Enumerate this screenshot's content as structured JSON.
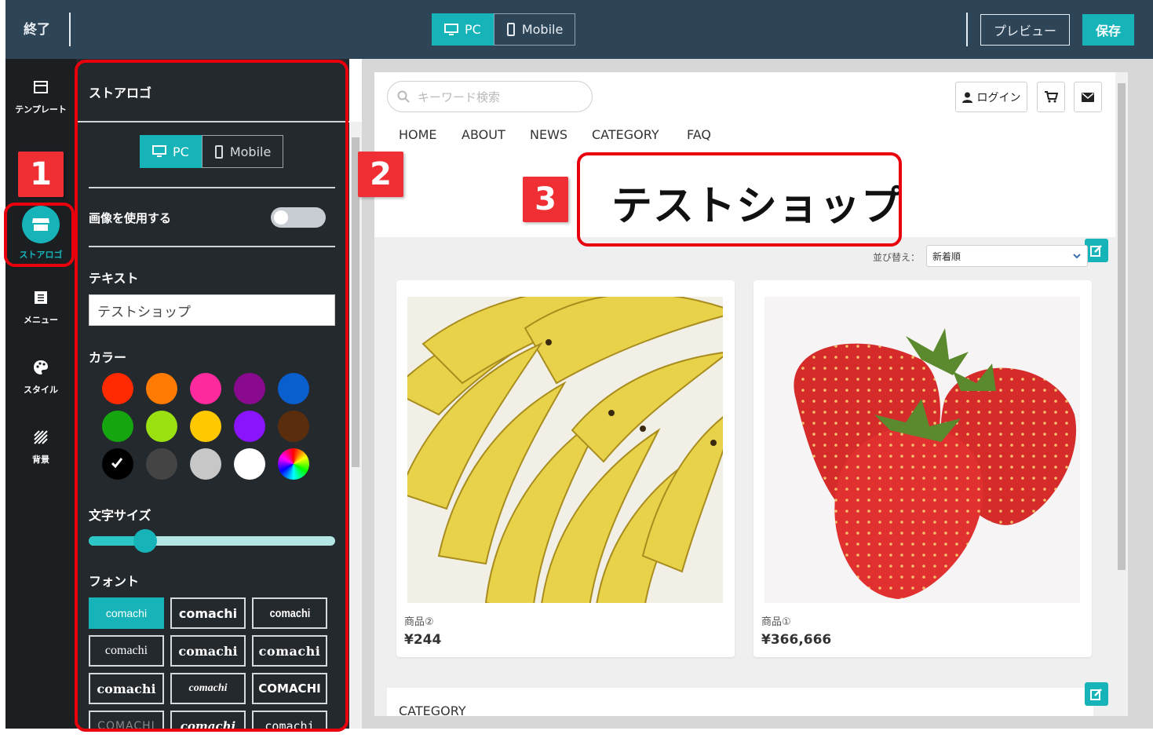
{
  "topbar": {
    "exit_label": "終了",
    "pc_label": "PC",
    "mobile_label": "Mobile",
    "preview_label": "プレビュー",
    "save_label": "保存"
  },
  "rail": {
    "items": [
      {
        "label": "テンプレート",
        "icon": "template-icon"
      },
      {
        "label": "ストアロゴ",
        "icon": "store-icon",
        "active": true
      },
      {
        "label": "メニュー",
        "icon": "menu-icon"
      },
      {
        "label": "スタイル",
        "icon": "palette-icon"
      },
      {
        "label": "背景",
        "icon": "background-icon"
      }
    ]
  },
  "panel": {
    "title": "ストアロゴ",
    "pc_label": "PC",
    "mobile_label": "Mobile",
    "use_image_label": "画像を使用する",
    "use_image_on": false,
    "text_label": "テキスト",
    "text_value": "テストショップ",
    "color_label": "カラー",
    "colors": [
      "#ff2a00",
      "#ff7a00",
      "#ff2a9e",
      "#8a0a8f",
      "#0a5fcf",
      "#15a60f",
      "#9be010",
      "#ffc800",
      "#8b14ff",
      "#5a2e0c",
      "#000000",
      "#444444",
      "#c7c7c7",
      "#ffffff",
      "rainbow"
    ],
    "selected_color": "#000000",
    "size_label": "文字サイズ",
    "size_value": 0.23,
    "font_label": "フォント",
    "fonts": [
      "comachi",
      "comachi",
      "comachi",
      "comachi",
      "comachi",
      "comachi",
      "comachi",
      "comachi",
      "COMACHI",
      "COMACHI",
      "comachi",
      "comachi"
    ]
  },
  "store": {
    "search_placeholder": "キーワード検索",
    "login_label": "ログイン",
    "nav": [
      "HOME",
      "ABOUT",
      "NEWS",
      "CATEGORY",
      "FAQ"
    ],
    "logo_text": "テストショップ",
    "sort_label": "並び替え：",
    "sort_value": "新着順",
    "products": [
      {
        "name": "商品②",
        "price": "¥244"
      },
      {
        "name": "商品①",
        "price": "¥366,666"
      }
    ],
    "category_title": "CATEGORY"
  },
  "annotations": [
    "1",
    "2",
    "3"
  ],
  "accent_color": "#16b4b9",
  "annotation_color": "#e8000c"
}
